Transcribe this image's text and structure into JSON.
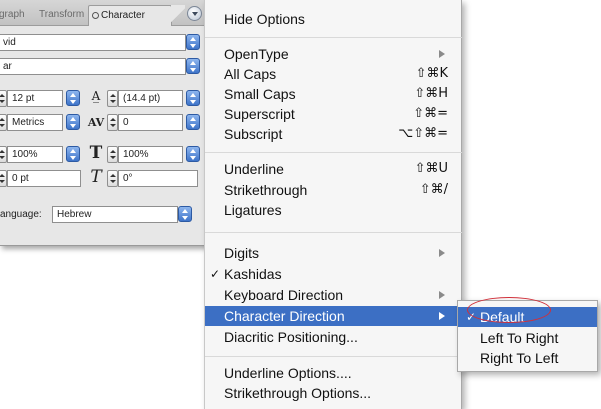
{
  "panel": {
    "tabs": [
      {
        "label": "graph"
      },
      {
        "label": "Transform"
      },
      {
        "label": "Character"
      }
    ],
    "font_family": "vid",
    "font_style": "ar",
    "size": "12 pt",
    "leading": "(14.4 pt)",
    "kerning": "Metrics",
    "tracking": "0",
    "vertical_scale": "100%",
    "horizontal_scale": "100%",
    "baseline_shift": "0 pt",
    "skew": "0°",
    "language_label": "anguage:",
    "language_value": "Hebrew"
  },
  "menu": {
    "items": {
      "hide_options": {
        "label": "Hide Options"
      },
      "opentype": {
        "label": "OpenType"
      },
      "all_caps": {
        "label": "All Caps",
        "shortcut": "⇧⌘K"
      },
      "small_caps": {
        "label": "Small Caps",
        "shortcut": "⇧⌘H"
      },
      "superscript": {
        "label": "Superscript",
        "shortcut": "⇧⌘="
      },
      "subscript": {
        "label": "Subscript",
        "shortcut": "⌥⇧⌘="
      },
      "underline": {
        "label": "Underline",
        "shortcut": "⇧⌘U"
      },
      "strikethrough": {
        "label": "Strikethrough",
        "shortcut": "⇧⌘/"
      },
      "ligatures": {
        "label": "Ligatures"
      },
      "digits": {
        "label": "Digits"
      },
      "kashidas": {
        "label": "Kashidas",
        "checked": true
      },
      "keyboard_direction": {
        "label": "Keyboard Direction"
      },
      "character_direction": {
        "label": "Character Direction"
      },
      "diacritic_positioning": {
        "label": "Diacritic Positioning..."
      },
      "underline_options": {
        "label": "Underline Options...."
      },
      "strikethrough_options": {
        "label": "Strikethrough Options..."
      }
    }
  },
  "submenu": {
    "items": {
      "default": {
        "label": "Default",
        "checked": true
      },
      "ltr": {
        "label": "Left To Right"
      },
      "rtl": {
        "label": "Right To Left"
      }
    }
  },
  "check_glyph": "✓",
  "colors": {
    "highlight": "#3c6fc4",
    "annotation": "#d0303a"
  }
}
